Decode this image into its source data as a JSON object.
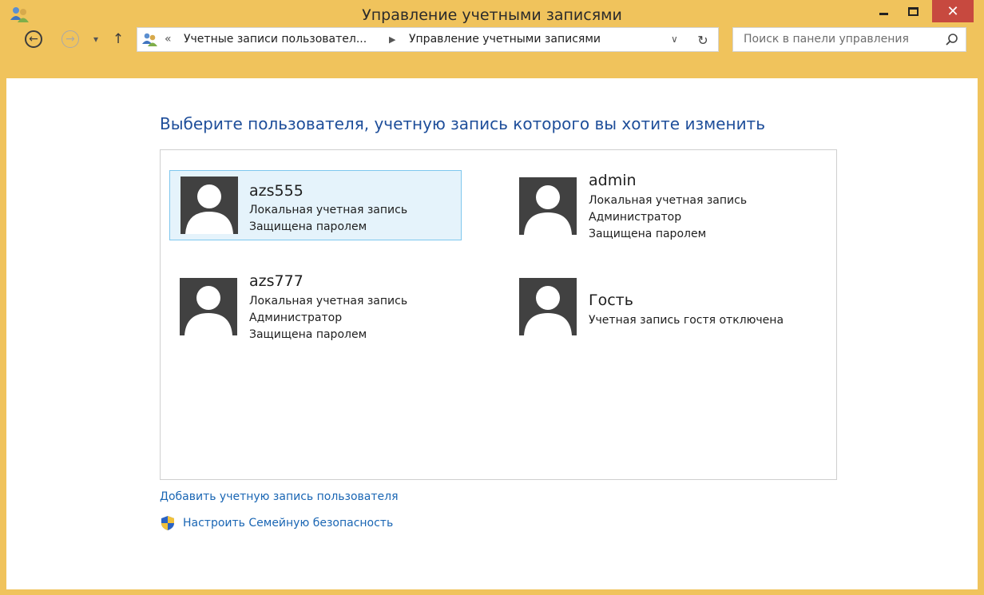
{
  "window": {
    "title": "Управление учетными записями",
    "close_glyph": "✕"
  },
  "nav": {
    "back_glyph": "←",
    "forward_glyph": "→",
    "dropdown_glyph": "▾",
    "up_glyph": "↑"
  },
  "address": {
    "prefix": "«",
    "crumbs": [
      "Учетные записи пользовател...",
      "Управление учетными записями"
    ],
    "separator": "▶",
    "dropdown_glyph": "∨",
    "refresh_glyph": "↻"
  },
  "search": {
    "placeholder": "Поиск в панели управления"
  },
  "main": {
    "heading": "Выберите пользователя, учетную запись которого вы хотите изменить",
    "accounts": [
      {
        "name": "azs555",
        "lines": [
          "Локальная учетная запись",
          "Защищена паролем"
        ],
        "selected": true
      },
      {
        "name": "admin",
        "lines": [
          "Локальная учетная запись",
          "Администратор",
          "Защищена паролем"
        ],
        "selected": false
      },
      {
        "name": "azs777",
        "lines": [
          "Локальная учетная запись",
          "Администратор",
          "Защищена паролем"
        ],
        "selected": false
      },
      {
        "name": "Гость",
        "lines": [
          "Учетная запись гостя отключена"
        ],
        "selected": false
      }
    ],
    "links": {
      "add_account": "Добавить учетную запись пользователя",
      "family_safety": "Настроить Семейную безопасность"
    }
  },
  "colors": {
    "frame": "#f0c35c",
    "close_button": "#c7493f",
    "heading": "#1e4e9a",
    "link": "#1a66b4",
    "selection_bg": "#e5f3fb",
    "selection_border": "#7ec7ee",
    "avatar_bg": "#414141"
  }
}
